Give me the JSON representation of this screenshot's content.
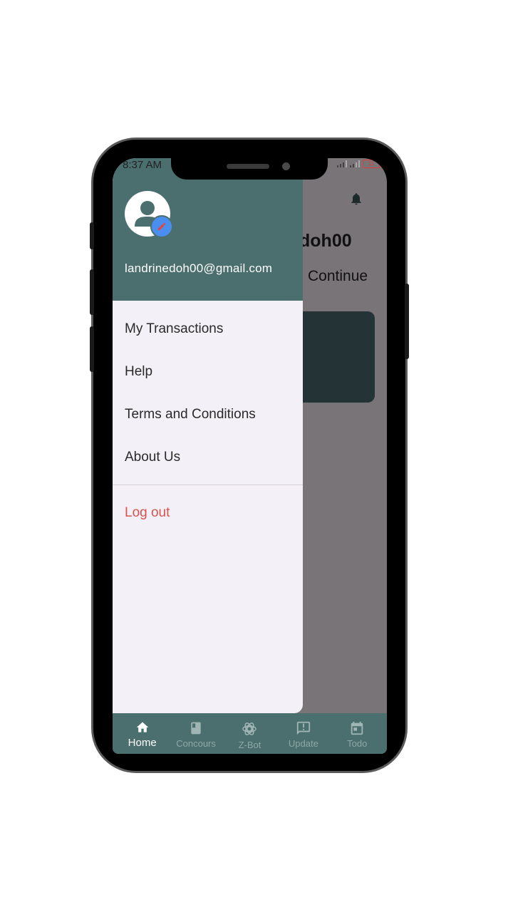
{
  "status_bar": {
    "time": "8:37 AM",
    "battery": "11"
  },
  "background": {
    "name_fragment": "doh00",
    "continue_label": "Continue"
  },
  "drawer": {
    "email": "landrinedoh00@gmail.com",
    "menu": [
      {
        "label": "My Transactions"
      },
      {
        "label": "Help"
      },
      {
        "label": "Terms and Conditions"
      },
      {
        "label": "About Us"
      }
    ],
    "logout_label": "Log out"
  },
  "bottom_nav": {
    "items": [
      {
        "label": "Home",
        "icon": "home-icon"
      },
      {
        "label": "Concours",
        "icon": "book-icon"
      },
      {
        "label": "Z-Bot",
        "icon": "openai-icon"
      },
      {
        "label": "Update",
        "icon": "alert-message-icon"
      },
      {
        "label": "Todo",
        "icon": "calendar-icon"
      }
    ],
    "active": "Home"
  },
  "colors": {
    "header": "#4a6f6e",
    "drawer_bg": "#f4f0f7",
    "logout": "#d9534f",
    "edit_badge": "#4a8ff0"
  }
}
